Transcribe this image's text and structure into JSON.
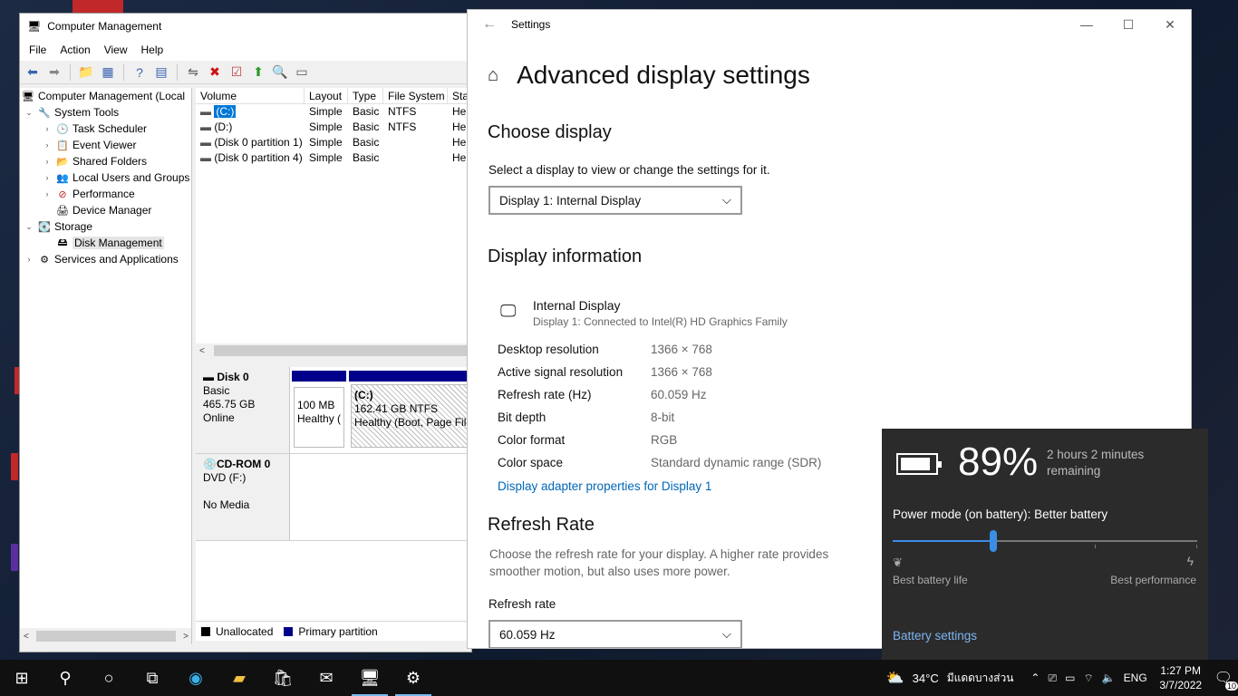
{
  "computer_management": {
    "title": "Computer Management",
    "menu": [
      "File",
      "Action",
      "View",
      "Help"
    ],
    "tree": [
      {
        "label": "Computer Management (Local",
        "level": 0,
        "icon": "computer-icon",
        "arrow": ""
      },
      {
        "label": "System Tools",
        "level": 1,
        "icon": "tools-icon",
        "arrow": "expanded"
      },
      {
        "label": "Task Scheduler",
        "level": 2,
        "icon": "clock-icon",
        "arrow": "collapsed"
      },
      {
        "label": "Event Viewer",
        "level": 2,
        "icon": "event-viewer-icon",
        "arrow": "collapsed"
      },
      {
        "label": "Shared Folders",
        "level": 2,
        "icon": "shared-folder-icon",
        "arrow": "collapsed"
      },
      {
        "label": "Local Users and Groups",
        "level": 2,
        "icon": "users-icon",
        "arrow": "collapsed"
      },
      {
        "label": "Performance",
        "level": 2,
        "icon": "performance-icon",
        "arrow": "collapsed"
      },
      {
        "label": "Device Manager",
        "level": 2,
        "icon": "device-manager-icon",
        "arrow": ""
      },
      {
        "label": "Storage",
        "level": 1,
        "icon": "storage-icon",
        "arrow": "expanded"
      },
      {
        "label": "Disk Management",
        "level": 2,
        "icon": "disk-management-icon",
        "arrow": "",
        "selected": true
      },
      {
        "label": "Services and Applications",
        "level": 1,
        "icon": "services-icon",
        "arrow": "collapsed"
      }
    ],
    "volume_headers": [
      "Volume",
      "Layout",
      "Type",
      "File System",
      "Sta"
    ],
    "volumes": [
      [
        "(C:)",
        "Simple",
        "Basic",
        "NTFS",
        "He"
      ],
      [
        "(D:)",
        "Simple",
        "Basic",
        "NTFS",
        "He"
      ],
      [
        "(Disk 0 partition 1)",
        "Simple",
        "Basic",
        "",
        "He"
      ],
      [
        "(Disk 0 partition 4)",
        "Simple",
        "Basic",
        "",
        "He"
      ]
    ],
    "disk0": {
      "name": "Disk 0",
      "type": "Basic",
      "size": "465.75 GB",
      "status": "Online",
      "part1_line1": "100 MB",
      "part1_line2": "Healthy (",
      "part2_name": "(C:)",
      "part2_line1": "162.41 GB NTFS",
      "part2_line2": "Healthy (Boot, Page File"
    },
    "cdrom0": {
      "name": "CD-ROM 0",
      "type": "DVD (F:)",
      "status": "No Media"
    },
    "legend": {
      "unallocated": "Unallocated",
      "primary": "Primary partition"
    }
  },
  "settings": {
    "app_title": "Settings",
    "page_title": "Advanced display settings",
    "choose_display_heading": "Choose display",
    "choose_display_text": "Select a display to view or change the settings for it.",
    "display_selected": "Display 1: Internal Display",
    "display_info_heading": "Display information",
    "display_name": "Internal Display",
    "display_connection": "Display 1: Connected to Intel(R) HD Graphics Family",
    "info": [
      {
        "key": "Desktop resolution",
        "value": "1366 × 768"
      },
      {
        "key": "Active signal resolution",
        "value": "1366 × 768"
      },
      {
        "key": "Refresh rate (Hz)",
        "value": "60.059 Hz"
      },
      {
        "key": "Bit depth",
        "value": "8-bit"
      },
      {
        "key": "Color format",
        "value": "RGB"
      },
      {
        "key": "Color space",
        "value": "Standard dynamic range (SDR)"
      }
    ],
    "adapter_link": "Display adapter properties for Display 1",
    "refresh_heading": "Refresh Rate",
    "refresh_desc": "Choose the refresh rate for your display. A higher rate provides smoother motion, but also uses more power.",
    "refresh_label": "Refresh rate",
    "refresh_selected": "60.059 Hz"
  },
  "battery": {
    "percent": "89%",
    "percent_value": 0.89,
    "remaining": "2 hours 2 minutes remaining",
    "power_mode": "Power mode (on battery): Better battery",
    "slider_position": 0.33,
    "left_label": "Best battery life",
    "right_label": "Best performance",
    "settings_link": "Battery settings"
  },
  "taskbar": {
    "weather_temp": "34°C",
    "weather_text": "มีแดดบางส่วน",
    "language": "ENG",
    "time": "1:27 PM",
    "date": "3/7/2022",
    "notification_count": "10"
  },
  "colors": {
    "accent": "#0067b8",
    "partition_blue": "#00008b",
    "battery_slider": "#3a8ee6"
  }
}
